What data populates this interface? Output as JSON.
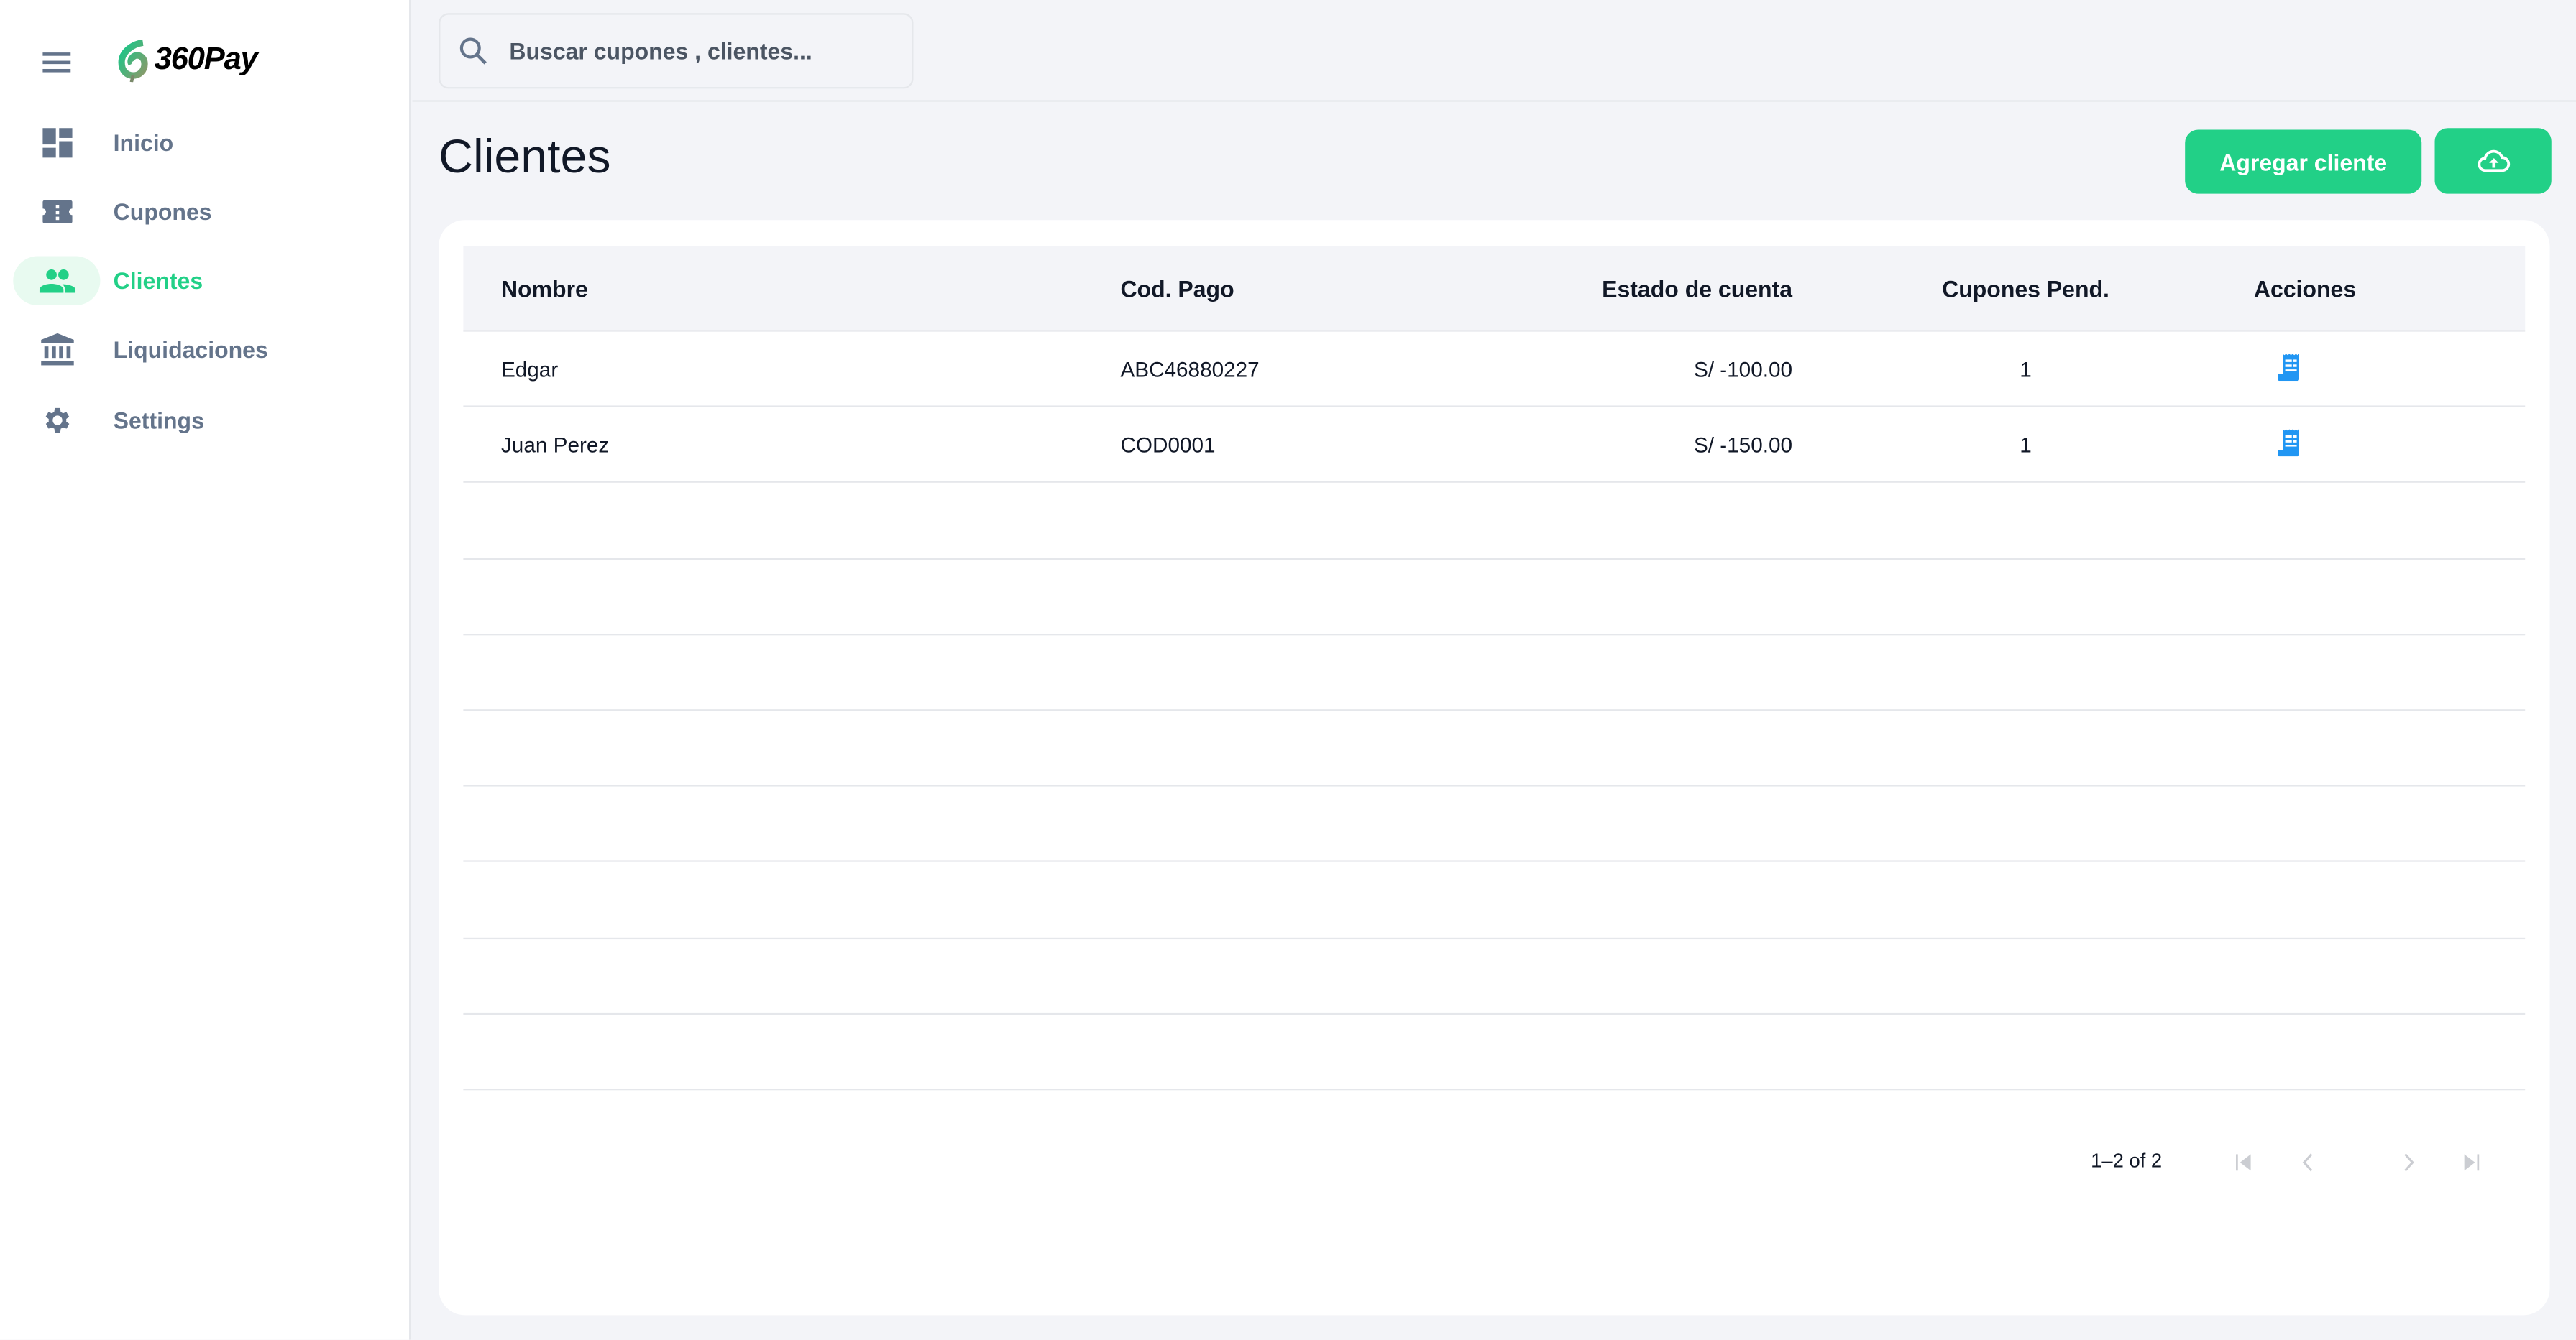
{
  "brand": {
    "name": "360Pay"
  },
  "sidebar": {
    "items": [
      {
        "label": "Inicio",
        "icon": "dashboard-icon"
      },
      {
        "label": "Cupones",
        "icon": "ticket-icon"
      },
      {
        "label": "Clientes",
        "icon": "people-icon",
        "active": true
      },
      {
        "label": "Liquidaciones",
        "icon": "bank-icon"
      },
      {
        "label": "Settings",
        "icon": "gear-icon"
      }
    ]
  },
  "search": {
    "placeholder": "Buscar cupones , clientes..."
  },
  "page": {
    "title": "Clientes",
    "add_button": "Agregar cliente",
    "upload_icon": "cloud-upload-icon"
  },
  "table": {
    "headers": [
      "Nombre",
      "Cod. Pago",
      "Estado de cuenta",
      "Cupones Pend.",
      "Acciones"
    ],
    "rows": [
      {
        "nombre": "Edgar",
        "cod_pago": "ABC46880227",
        "estado": "S/ -100.00",
        "cupones": "1",
        "action_icon": "receipt-icon"
      },
      {
        "nombre": "Juan Perez",
        "cod_pago": "COD0001",
        "estado": "S/ -150.00",
        "cupones": "1",
        "action_icon": "receipt-icon"
      }
    ],
    "pagination": {
      "info": "1–2 of 2"
    }
  },
  "colors": {
    "accent": "#22d087",
    "icon_blue": "#2196f3",
    "muted": "#64748b"
  }
}
